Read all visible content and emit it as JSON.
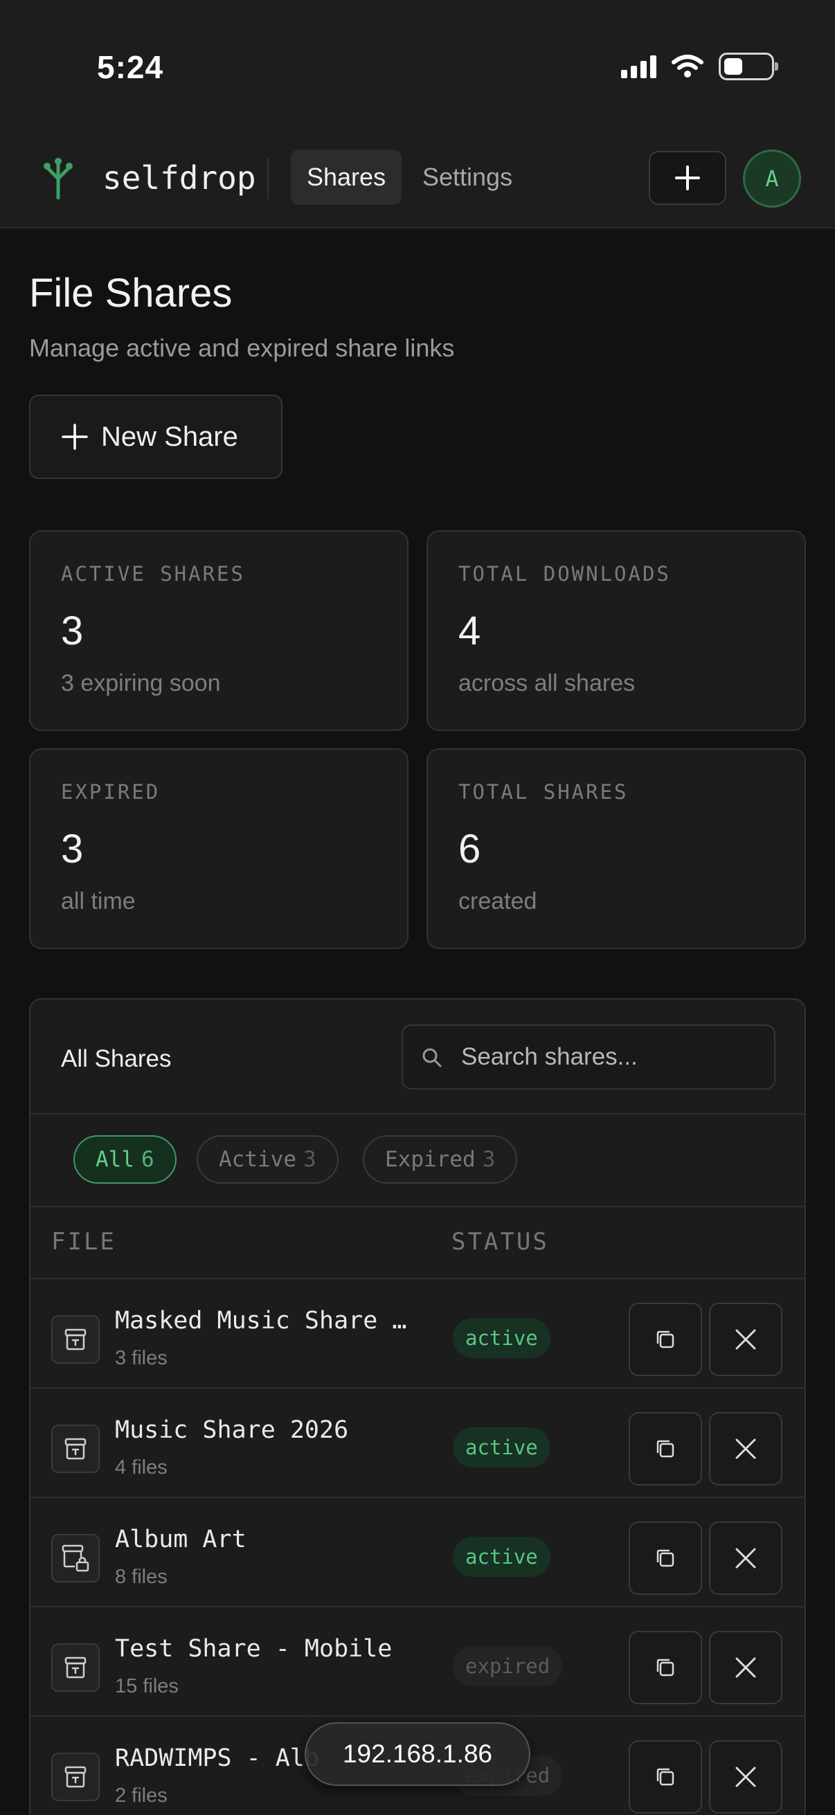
{
  "status_bar": {
    "time": "5:24"
  },
  "header": {
    "brand": "selfdrop",
    "tabs": [
      {
        "label": "Shares",
        "selected": true
      },
      {
        "label": "Settings",
        "selected": false
      }
    ],
    "new_button_icon": "plus-icon",
    "avatar_initial": "A",
    "accent_color": "#62d08b"
  },
  "page": {
    "title": "File Shares",
    "subtitle": "Manage active and expired share links",
    "new_share_label": "New Share"
  },
  "stats": [
    {
      "label": "ACTIVE SHARES",
      "value": "3",
      "note": "3 expiring soon"
    },
    {
      "label": "TOTAL DOWNLOADS",
      "value": "4",
      "note": "across all shares"
    },
    {
      "label": "EXPIRED",
      "value": "3",
      "note": "all time"
    },
    {
      "label": "TOTAL SHARES",
      "value": "6",
      "note": "created"
    }
  ],
  "shares_panel": {
    "title": "All Shares",
    "search_placeholder": "Search shares...",
    "filters": [
      {
        "label": "All",
        "count": "6",
        "selected": true
      },
      {
        "label": "Active",
        "count": "3",
        "selected": false
      },
      {
        "label": "Expired",
        "count": "3",
        "selected": false
      }
    ],
    "columns": [
      "FILE",
      "STATUS"
    ],
    "rows": [
      {
        "name": "Masked Music Share 2…",
        "files": "3 files",
        "status": "active",
        "icon": "archive-icon"
      },
      {
        "name": "Music Share 2026",
        "files": "4 files",
        "status": "active",
        "icon": "archive-icon"
      },
      {
        "name": "Album Art",
        "files": "8 files",
        "status": "active",
        "icon": "locked-archive-icon"
      },
      {
        "name": "Test Share - Mobile",
        "files": "15 files",
        "status": "expired",
        "icon": "archive-icon"
      },
      {
        "name": "RADWIMPS - Alb",
        "files": "2 files",
        "status": "expired",
        "icon": "archive-icon"
      }
    ]
  },
  "overlay": {
    "address": "192.168.1.86"
  }
}
